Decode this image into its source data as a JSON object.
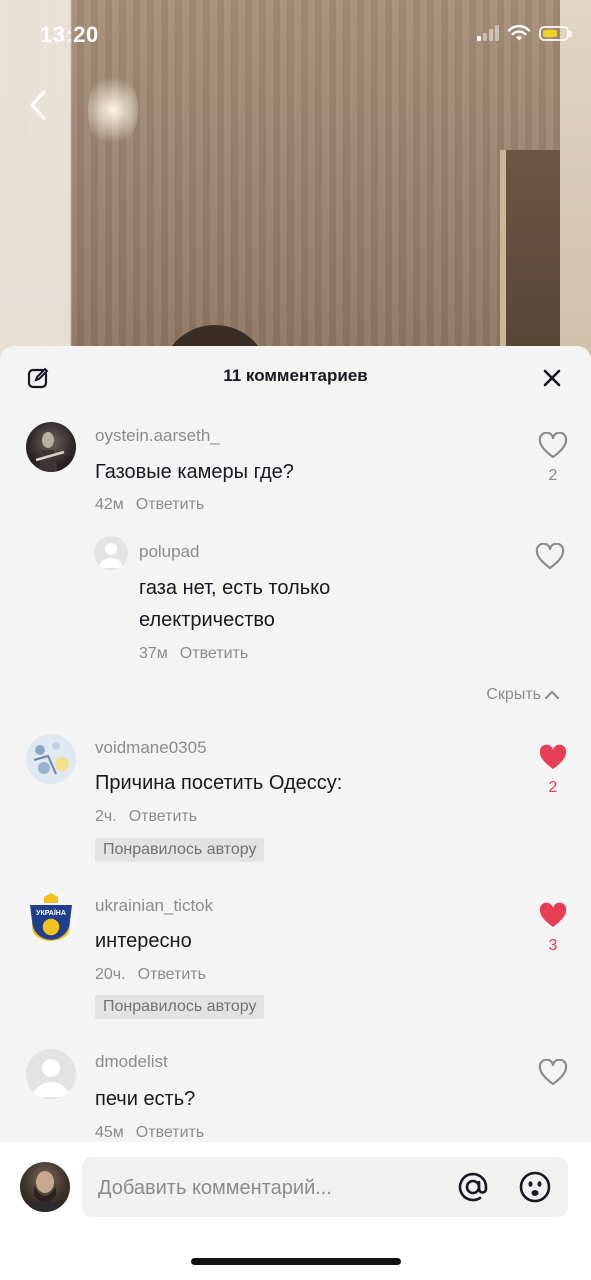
{
  "status_bar": {
    "time": "13:20"
  },
  "header": {
    "title": "11 комментариев"
  },
  "comments": [
    {
      "username": "oystein.aarseth_",
      "text": "Газовые камеры где?",
      "age": "42м",
      "reply_label": "Ответить",
      "likes": "2",
      "liked": false,
      "replies": [
        {
          "username": "polupad",
          "text_line1": "газа нет, есть только",
          "text_line2": "електричество",
          "age": "37м",
          "reply_label": "Ответить"
        }
      ],
      "hide_label": "Скрыть"
    },
    {
      "username": "voidmane0305",
      "text": "Причина посетить Одессу:",
      "age": "2ч.",
      "reply_label": "Ответить",
      "likes": "2",
      "liked": true,
      "badge": "Понравилось автору"
    },
    {
      "username": "ukrainian_tictok",
      "text": "интересно",
      "age": "20ч.",
      "reply_label": "Ответить",
      "likes": "3",
      "liked": true,
      "badge": "Понравилось автору",
      "avatar_text": "УКРАЇНА"
    },
    {
      "username": "dmodelist",
      "text": "печи есть?",
      "age": "45м",
      "reply_label": "Ответить",
      "liked": false
    }
  ],
  "composer": {
    "placeholder": "Добавить комментарий..."
  },
  "colors": {
    "like_red": "#e83e55",
    "text_primary": "#161823",
    "text_secondary": "#8a8b91"
  }
}
